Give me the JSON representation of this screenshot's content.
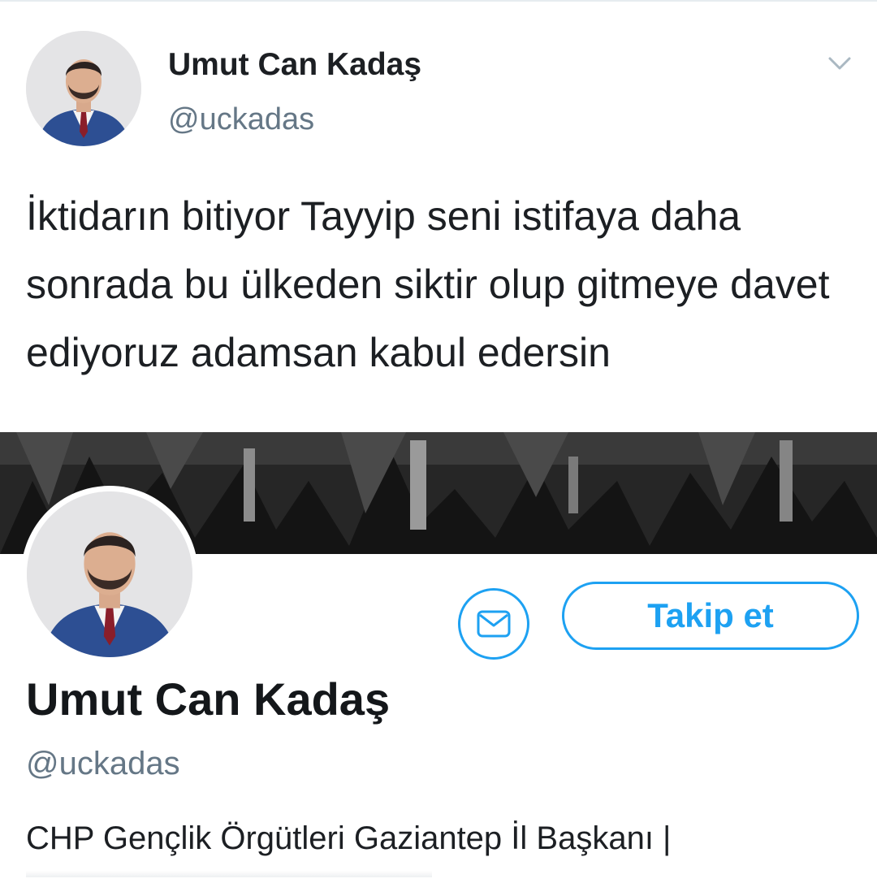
{
  "tweet": {
    "author_name": "Umut Can Kadaş",
    "author_handle": "@uckadas",
    "text": "İktidarın bitiyor Tayyip seni istifaya daha sonrada bu ülkeden siktir olup gitmeye davet ediyoruz adamsan kabul edersin",
    "menu_icon": "chevron-down-icon"
  },
  "profile": {
    "name": "Umut Can Kadaş",
    "handle": "@uckadas",
    "bio": "CHP Gençlik Örgütleri Gaziantep İl Başkanı |",
    "message_icon": "envelope-icon",
    "follow_label": "Takip et"
  },
  "colors": {
    "accent": "#1da1f2",
    "secondary_text": "#657786",
    "primary_text": "#14171a"
  }
}
